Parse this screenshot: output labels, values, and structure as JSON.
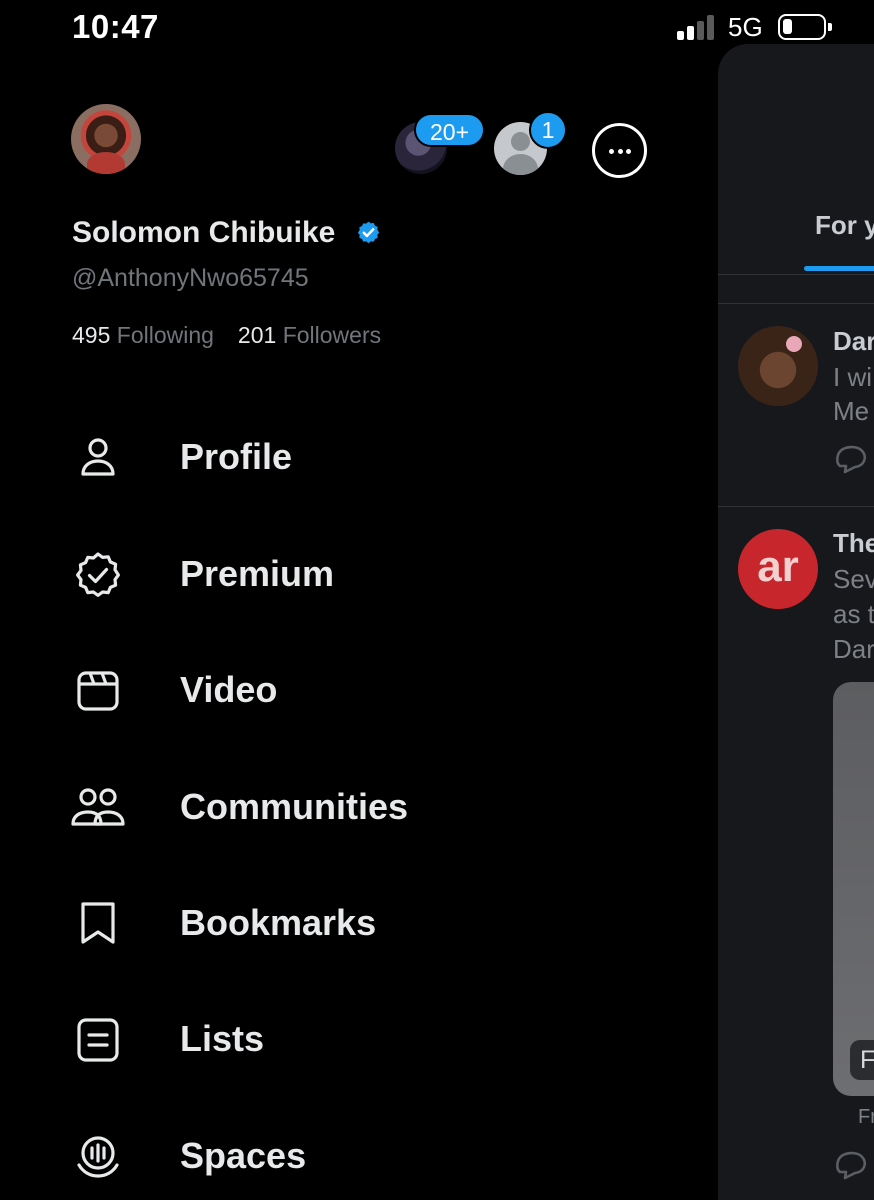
{
  "status_bar": {
    "time": "10:47",
    "network": "5G"
  },
  "drawer": {
    "user": {
      "display_name": "Solomon Chibuike",
      "handle": "@AnthonyNwo65745",
      "following_count": "495",
      "following_label": "Following",
      "followers_count": "201",
      "followers_label": "Followers"
    },
    "accounts": {
      "badge_other_accounts": "20+",
      "badge_account_two": "1"
    },
    "menu": [
      {
        "label": "Profile",
        "icon": "person-icon"
      },
      {
        "label": "Premium",
        "icon": "verified-badge-icon"
      },
      {
        "label": "Video",
        "icon": "video-clapper-icon"
      },
      {
        "label": "Communities",
        "icon": "people-icon"
      },
      {
        "label": "Bookmarks",
        "icon": "bookmark-icon"
      },
      {
        "label": "Lists",
        "icon": "list-icon"
      },
      {
        "label": "Spaces",
        "icon": "microphone-icon"
      }
    ]
  },
  "feed_peek": {
    "tab_label": "For y",
    "posts": [
      {
        "name": "Dar",
        "lines": [
          "I wi",
          "Me"
        ]
      },
      {
        "name": "The",
        "avatar_text": "ar",
        "lines": [
          "Sev",
          "as t",
          "Dar"
        ],
        "media_tag": "F",
        "caption": "Fr"
      }
    ]
  },
  "colors": {
    "accent": "#1d9bf0",
    "background": "#000000",
    "text_primary": "#e7e9ea",
    "text_secondary": "#71767b"
  }
}
